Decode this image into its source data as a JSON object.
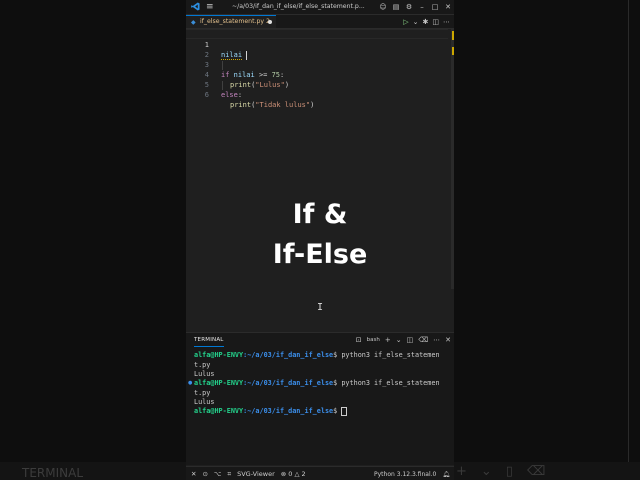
{
  "window": {
    "title": "~/a/03/if_dan_if_else/if_else_statement.p...",
    "menu_icon": "≡"
  },
  "tab": {
    "filename": "if_else_statement.py 2"
  },
  "editor": {
    "line_numbers": [
      "1",
      "2",
      "3",
      "4",
      "5",
      "6"
    ],
    "line1": "nilai",
    "line3_kw": "if",
    "line3_var": "nilai",
    "line3_op": " >= ",
    "line3_num": "75",
    "line3_end": ":",
    "line4_fn": "print",
    "line4_str": "\"Lulus\"",
    "line5_kw": "else",
    "line5_end": ":",
    "line6_fn": "print",
    "line6_str": "\"Tidak lulus\""
  },
  "overlay": {
    "line1": "If &",
    "line2": "If-Else"
  },
  "panel": {
    "tab_label": "TERMINAL",
    "shell": "bash"
  },
  "terminal": {
    "prompt_user": "alfa@HP-ENVY",
    "prompt_path": ":~/a/03/if_dan_if_else",
    "cmd1": "$ python3 if_else_statemen",
    "cmd1_wrap": "t.py",
    "out1": "Lulus",
    "cmd2": "$ python3 if_else_statemen",
    "cmd2_wrap": "t.py",
    "out2": "Lulus",
    "prompt3_end": "$ "
  },
  "statusbar": {
    "errors": "0",
    "warnings": "2",
    "extension": "SVG-Viewer",
    "interpreter": "Python 3.12.3.final.0"
  },
  "background": {
    "terminal_label": "TERMINAL"
  },
  "colors": {
    "accent": "#0078d4",
    "prompt_green": "#23d18b",
    "path_blue": "#3b8eea",
    "modified_tab": "#e2c08d"
  }
}
